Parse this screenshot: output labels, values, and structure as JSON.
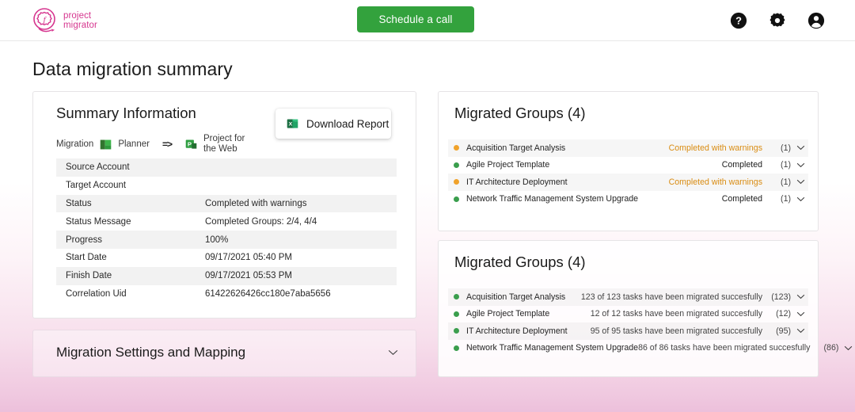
{
  "header": {
    "logo": {
      "line1": "project",
      "line2": "migrator",
      "icon": "gear-f-logo-icon",
      "color": "#d6368f"
    },
    "schedule_button": "Schedule a call",
    "schedule_button_color": "#33a23d",
    "icons": [
      {
        "name": "help-icon",
        "glyph": "?"
      },
      {
        "name": "settings-gear-icon",
        "glyph": "gear"
      },
      {
        "name": "account-icon",
        "glyph": "person"
      }
    ]
  },
  "page": {
    "title": "Data migration summary"
  },
  "summary": {
    "title": "Summary Information",
    "migration_label": "Migration",
    "source_product": "Planner",
    "source_icon": "planner-icon",
    "arrow": "=>",
    "target_product": "Project for\nthe Web",
    "target_product_line1": "Project for",
    "target_product_line2": "the Web",
    "target_icon": "project-icon",
    "download_button": "Download Report",
    "download_icon": "excel-icon",
    "rows": [
      {
        "key": "Source Account",
        "value": ""
      },
      {
        "key": "Target Account",
        "value": ""
      },
      {
        "key": "Status",
        "value": "Completed with warnings"
      },
      {
        "key": "Status Message",
        "value": "Completed Groups: 2/4, 4/4"
      },
      {
        "key": "Progress",
        "value": "100%"
      },
      {
        "key": "Start Date",
        "value": "09/17/2021 05:40 PM"
      },
      {
        "key": "Finish Date",
        "value": "09/17/2021 05:53 PM"
      },
      {
        "key": "Correlation Uid",
        "value": "61422626426cc180e7aba5656"
      }
    ]
  },
  "settings": {
    "label": "Migration Settings and Mapping",
    "chevron": "chevron-down-icon",
    "expanded": false
  },
  "groups_panel_1": {
    "title": "Migrated Groups (4)",
    "rows": [
      {
        "name": "Acquisition Target Analysis",
        "status": "Completed with warnings",
        "state": "warn",
        "count": "(1)"
      },
      {
        "name": "Agile Project Template",
        "status": "Completed",
        "state": "ok",
        "count": "(1)"
      },
      {
        "name": "IT Architecture Deployment",
        "status": "Completed with warnings",
        "state": "warn",
        "count": "(1)"
      },
      {
        "name": "Network Traffic Management System Upgrade",
        "status": "Completed",
        "state": "ok",
        "count": "(1)"
      }
    ]
  },
  "groups_panel_2": {
    "title": "Migrated Groups (4)",
    "rows": [
      {
        "name": "Acquisition Target Analysis",
        "status": "123 of 123 tasks have been migrated succesfully",
        "state": "ok",
        "count": "(123)"
      },
      {
        "name": "Agile Project Template",
        "status": "12 of 12 tasks have been migrated succesfully",
        "state": "ok",
        "count": "(12)"
      },
      {
        "name": "IT Architecture Deployment",
        "status": "95 of 95 tasks have been migrated succesfully",
        "state": "ok",
        "count": "(95)"
      },
      {
        "name": "Network Traffic Management System Upgrade",
        "status": "86 of 86 tasks have been migrated succesfully",
        "state": "ok",
        "count": "(86)"
      }
    ]
  },
  "colors": {
    "accent_pink": "#d6368f",
    "green": "#33a23d",
    "status_ok_dot": "#3a9e4d",
    "status_warn_dot": "#f0a22a",
    "status_warn_text": "#d98c12"
  }
}
